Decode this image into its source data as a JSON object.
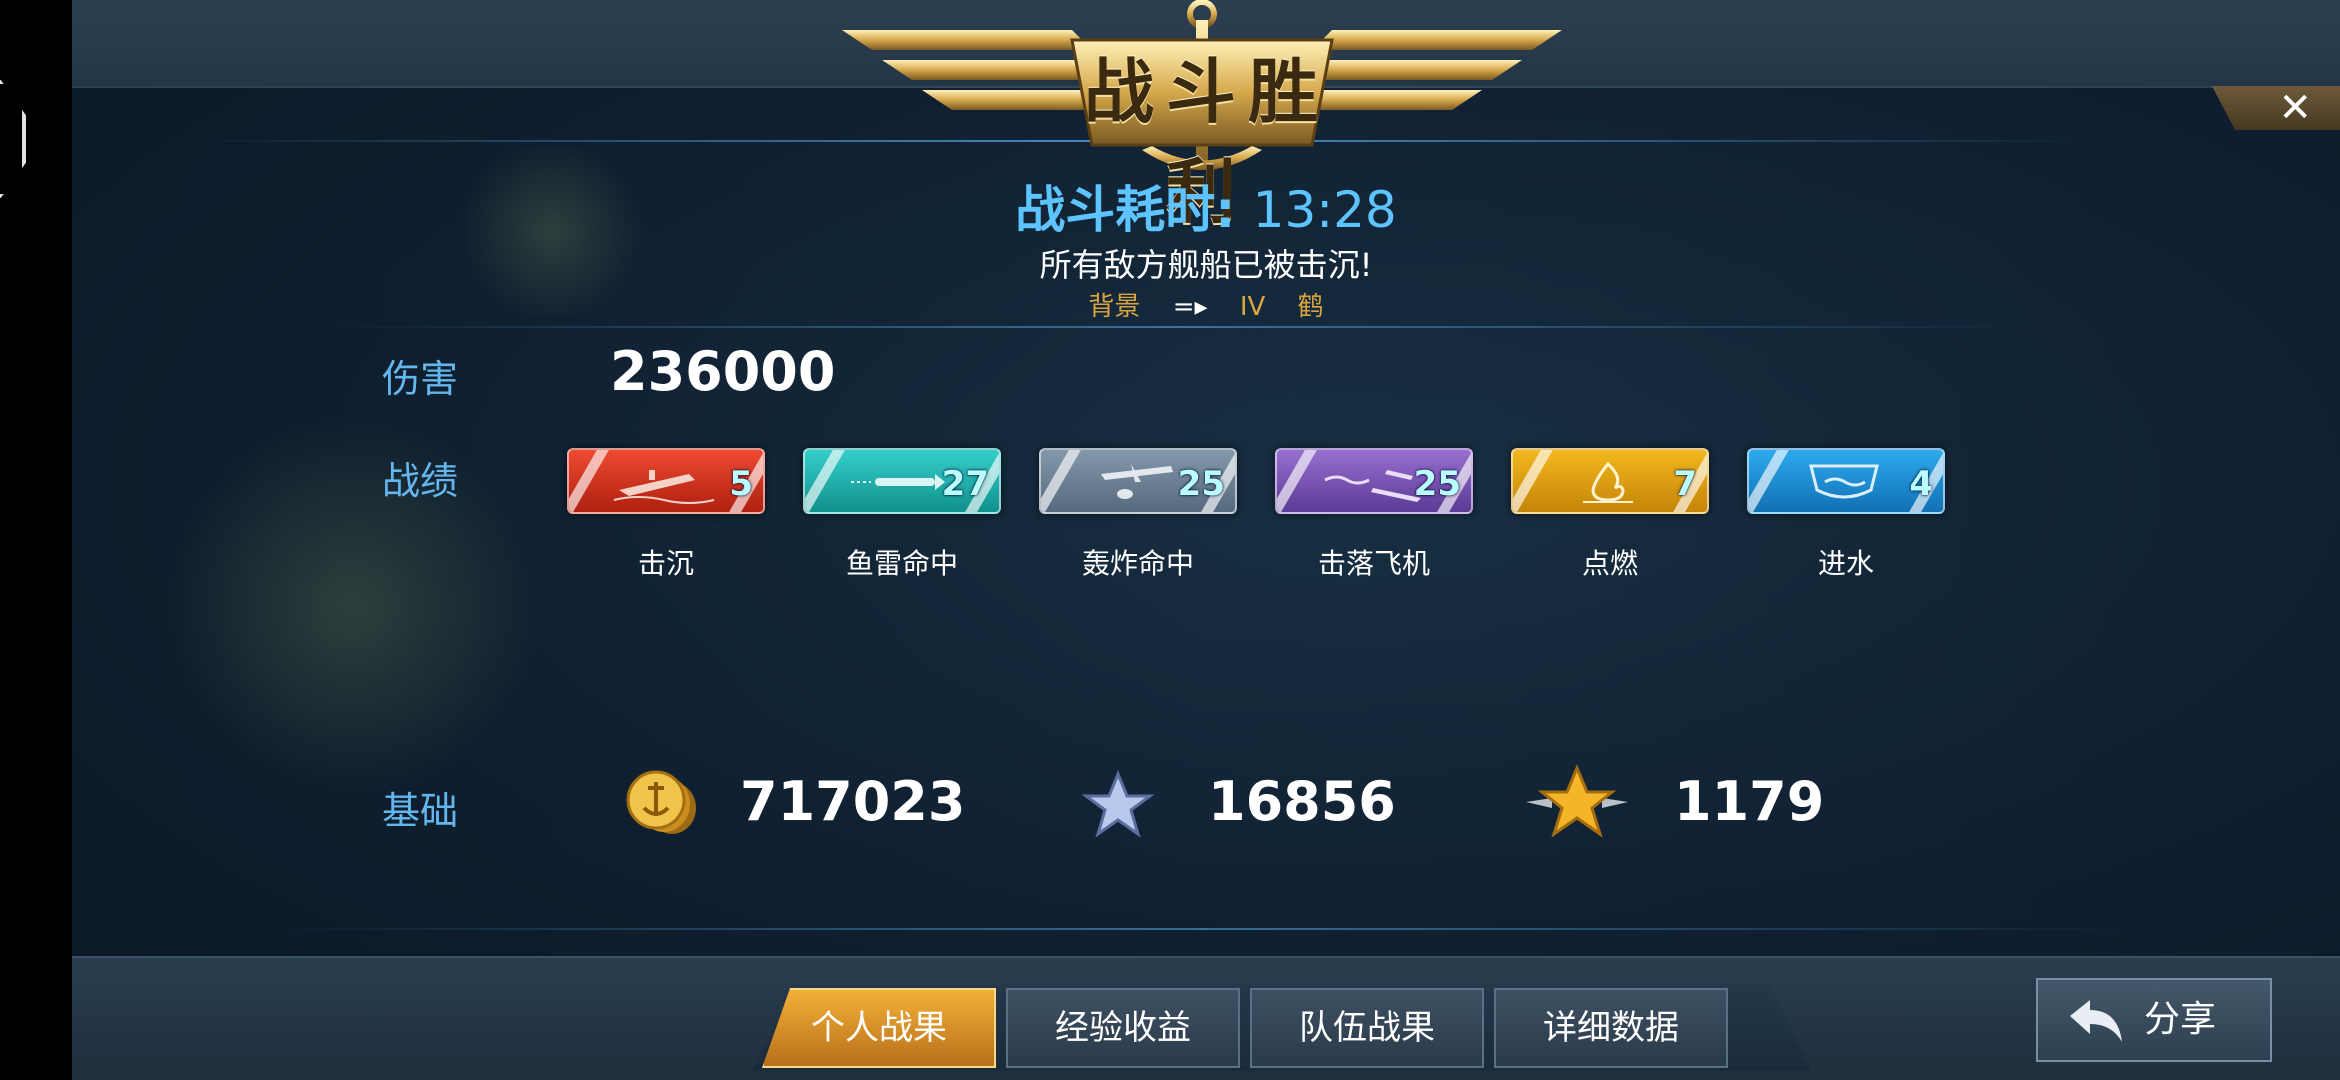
{
  "header": {
    "title": "战斗胜利",
    "close_label": "✕",
    "duration_label": "战斗耗时:",
    "duration_value": "13:28",
    "subtitle": "所有敌方舰船已被击沉!",
    "background_label": "背景",
    "background_arrow": "=▸",
    "ship_tier": "IV",
    "ship_name": "鹤"
  },
  "damage": {
    "label": "伤害",
    "value": "236000"
  },
  "achievements": {
    "label": "战绩",
    "items": [
      {
        "name": "击沉",
        "count": "5",
        "color": "#d8321f",
        "icon": "sinking-ship-icon"
      },
      {
        "name": "鱼雷命中",
        "count": "27",
        "color": "#1fb3b0",
        "icon": "torpedo-icon"
      },
      {
        "name": "轰炸命中",
        "count": "25",
        "color": "#6f8396",
        "icon": "bomber-icon"
      },
      {
        "name": "击落飞机",
        "count": "25",
        "color": "#7a4fb5",
        "icon": "plane-shotdown-icon"
      },
      {
        "name": "点燃",
        "count": "7",
        "color": "#e9a412",
        "icon": "fire-icon"
      },
      {
        "name": "进水",
        "count": "4",
        "color": "#1f93d6",
        "icon": "flooding-icon"
      }
    ]
  },
  "base": {
    "label": "基础",
    "credits": "717023",
    "experience": "16856",
    "free_experience": "1179"
  },
  "tabs": [
    {
      "label": "个人战果",
      "active": true
    },
    {
      "label": "经验收益",
      "active": false
    },
    {
      "label": "队伍战果",
      "active": false
    },
    {
      "label": "详细数据",
      "active": false
    }
  ],
  "share_label": "分享"
}
